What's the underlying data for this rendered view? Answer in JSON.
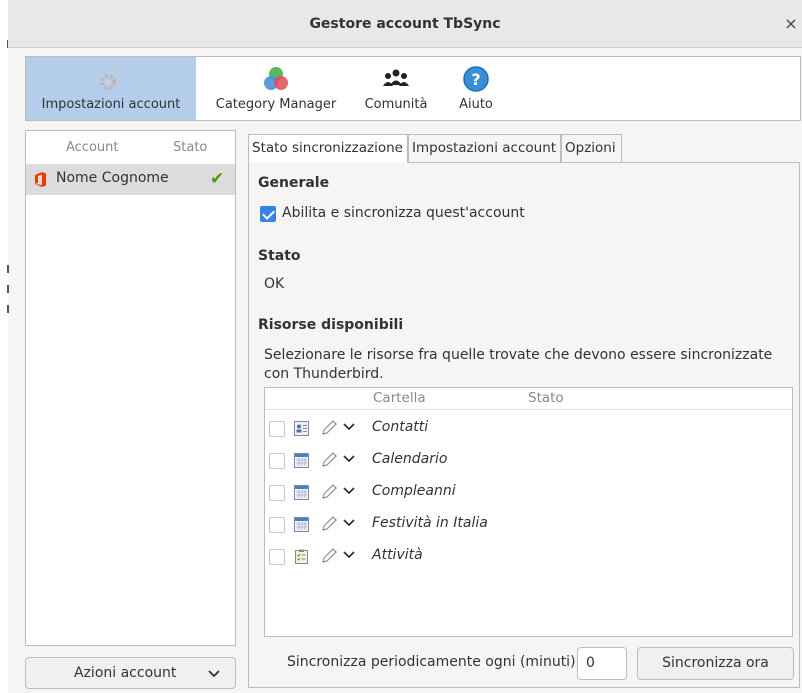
{
  "window": {
    "title": "Gestore account TbSync",
    "close_glyph": "×"
  },
  "toolbar": {
    "items": [
      {
        "label": "Impostazioni account",
        "icon": "gears-icon",
        "active": true
      },
      {
        "label": "Category Manager",
        "icon": "colored-circles-icon",
        "active": false
      },
      {
        "label": "Comunità",
        "icon": "people-icon",
        "active": false
      },
      {
        "label": "Aiuto",
        "icon": "help-icon",
        "active": false
      }
    ]
  },
  "accounts": {
    "headers": {
      "account": "Account",
      "status": "Stato"
    },
    "rows": [
      {
        "name": "Nome Cognome",
        "icon": "office-icon",
        "status_icon": "checkmark-icon"
      }
    ],
    "actions_label": "Azioni account"
  },
  "tabs": [
    {
      "label": "Stato sincronizzazione",
      "selected": true
    },
    {
      "label": "Impostazioni account",
      "selected": false
    },
    {
      "label": "Opzioni",
      "selected": false
    }
  ],
  "general": {
    "heading": "Generale",
    "enable_label": "Abilita e sincronizza quest'account",
    "enable_checked": true
  },
  "status": {
    "heading": "Stato",
    "value": "OK"
  },
  "resources": {
    "heading": "Risorse disponibili",
    "description": "Selezionare le risorse fra quelle trovate che devono essere sincronizzate con Thunderbird.",
    "columns": {
      "folder": "Cartella",
      "status": "Stato"
    },
    "rows": [
      {
        "name": "Contatti",
        "type_icon": "addressbook-icon",
        "checked": false
      },
      {
        "name": "Calendario",
        "type_icon": "calendar-icon",
        "checked": false
      },
      {
        "name": "Compleanni",
        "type_icon": "calendar-icon",
        "checked": false
      },
      {
        "name": "Festività in Italia",
        "type_icon": "calendar-icon",
        "checked": false
      },
      {
        "name": "Attività",
        "type_icon": "tasks-icon",
        "checked": false
      }
    ]
  },
  "sync": {
    "interval_label": "Sincronizza periodicamente ogni (minuti)",
    "interval_value": "0",
    "sync_now_label": "Sincronizza ora"
  },
  "colors": {
    "accent": "#3584e4",
    "active_toolbar": "#b4cdeb",
    "ok_green": "#4e9a06"
  }
}
